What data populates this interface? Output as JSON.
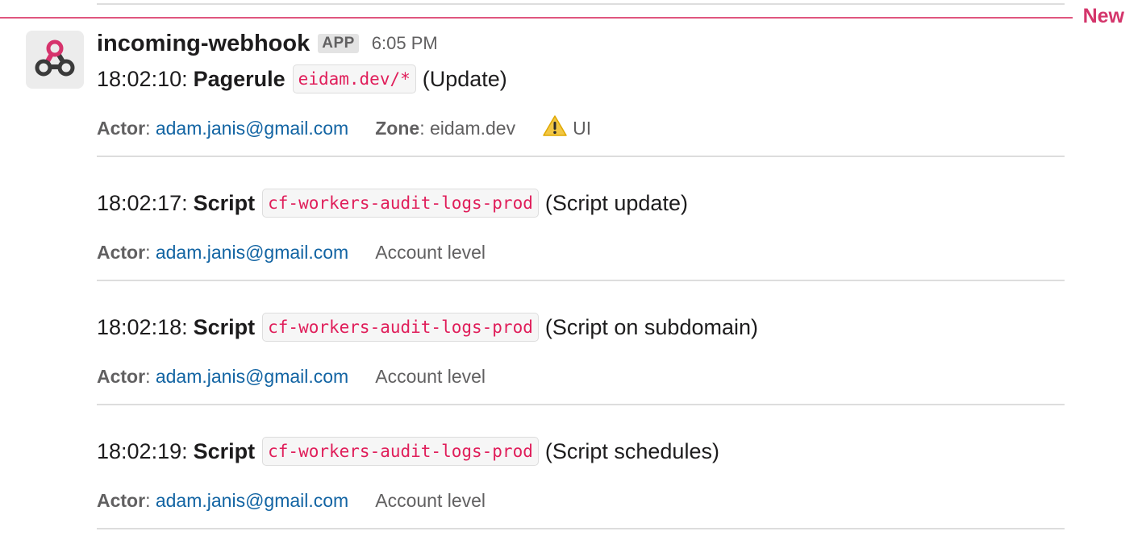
{
  "divider": {
    "label": "New"
  },
  "message": {
    "sender": "incoming-webhook",
    "badge": "APP",
    "time": "6:05 PM",
    "avatar_icon": "webhook-icon",
    "entries": [
      {
        "time": "18:02:10:",
        "kind": "Pagerule",
        "code": "eidam.dev/*",
        "action": "(Update)",
        "actor_label": "Actor",
        "actor": "adam.janis@gmail.com",
        "zone_label": "Zone",
        "zone": "eidam.dev",
        "warning_icon": "warning-icon",
        "source": "UI"
      },
      {
        "time": "18:02:17:",
        "kind": "Script",
        "code": "cf-workers-audit-logs-prod",
        "action": "(Script update)",
        "actor_label": "Actor",
        "actor": "adam.janis@gmail.com",
        "scope": "Account level"
      },
      {
        "time": "18:02:18:",
        "kind": "Script",
        "code": "cf-workers-audit-logs-prod",
        "action": "(Script on subdomain)",
        "actor_label": "Actor",
        "actor": "adam.janis@gmail.com",
        "scope": "Account level"
      },
      {
        "time": "18:02:19:",
        "kind": "Script",
        "code": "cf-workers-audit-logs-prod",
        "action": "(Script schedules)",
        "actor_label": "Actor",
        "actor": "adam.janis@gmail.com",
        "scope": "Account level"
      }
    ]
  },
  "colors": {
    "new_divider": "#e0567f",
    "code_text": "#e01e5a",
    "link": "#1264a3",
    "muted": "#616061"
  }
}
